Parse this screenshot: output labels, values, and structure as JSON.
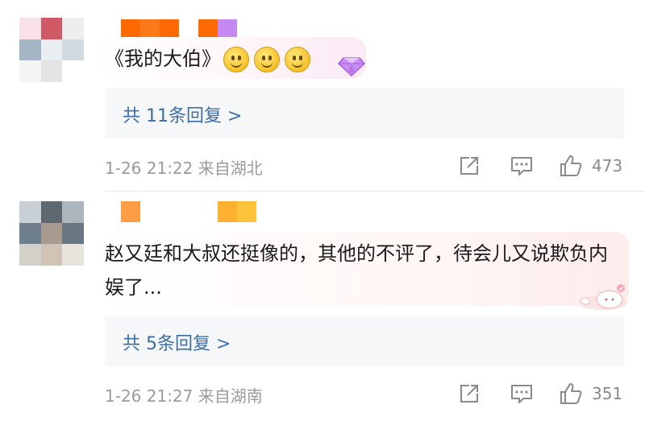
{
  "comments": [
    {
      "text": "《我的大伯》",
      "emoji_count": 3,
      "replies_label": "共 11条回复 >",
      "time": "1-26 21:22",
      "location": "来自湖北",
      "likes": "473",
      "avatar_colors": [
        "#f9dfe8",
        "#cf5a66",
        "#eeeeee",
        "#a4b6c6",
        "#e9eef3",
        "#d2d9df",
        "#f5f5f5",
        "#e4e4e4",
        "#ffffff"
      ],
      "name_colors": [
        "#ff6a00",
        "#ff7a1a",
        "#ff6a00",
        "#ffffff",
        "#ff6a00",
        "#c48af2"
      ]
    },
    {
      "text": "赵又廷和大叔还挺像的，其他的不评了，待会儿又说欺负内娱了...",
      "replies_label": "共 5条回复 >",
      "time": "1-26 21:27",
      "location": "来自湖南",
      "likes": "351",
      "avatar_colors": [
        "#c8d0d6",
        "#5f6770",
        "#aeb6bd",
        "#6f7f8d",
        "#a89a8e",
        "#6a7682",
        "#d3cfc9",
        "#cfc4b6",
        "#e8e3dc"
      ],
      "name_colors": [
        "#ff9c45",
        "#ffffff",
        "#ffffff",
        "#ffffff",
        "#ffffff",
        "#ffb030",
        "#ffc23a"
      ]
    }
  ],
  "icons": {
    "share": "share-icon",
    "comment": "comment-icon",
    "like": "thumbs-up-icon",
    "badge": "diamond-badge-icon",
    "decoration": "cat-sticker-icon"
  },
  "colors": {
    "link": "#3d6ea8",
    "meta": "#9b9b9b",
    "reply_bg": "#f6f7f9"
  }
}
